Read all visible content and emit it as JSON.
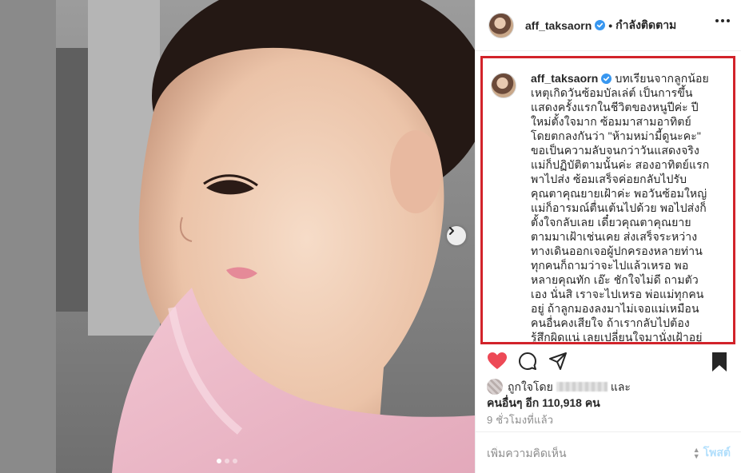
{
  "post": {
    "username": "aff_taksaorn",
    "separator": "•",
    "follow_status": "กำลังติดตาม",
    "caption": "บทเรียนจากลูกน้อย\nเหตุเกิดวันซ้อมบัลเล่ต์ เป็นการขึ้น\nแสดงครั้งแรกในชีวิตของหนูปีค่ะ ปี\nใหม่ตั้งใจมาก ซ้อมมาสามอาทิตย์\nโดยตกลงกันว่า \"ห้ามหม่ามี้ดูนะคะ\"\nขอเป็นความลับจนกว่าวันแสดงจริง\nแม่ก็ปฏิบัติตามนั้นค่ะ สองอาทิตย์แรก\nพาไปส่ง ซ้อมเสร็จค่อยกลับไปรับ\nคุณตาคุณยายเฝ้าค่ะ พอวันซ้อมใหญ่\nแม่ก็อารมณ์ตื่นเต้นไปด้วย พอไปส่งก็\nตั้งใจกลับเลย เดี๋ยวคุณตาคุณยาย\nตามมาเฝ้าเช่นเคย ส่งเสร็จระหว่าง\nทางเดินออกเจอผู้ปกครองหลายท่าน\nทุกคนก็ถามว่าจะไปแล้วเหรอ พอ\nหลายคุณทัก เอ๊ะ ชักใจไม่ดี ถามตัว\nเอง นั่นสิ เราจะไปเหรอ พ่อแม่ทุกคน\nอยู่ ถ้าลูกมองลงมาไม่เจอแม่เหมือน\nคนอื่นคงเสียใจ ถ้าเรากลับไปต้อง\nรู้สึกผิดแน่ เลยเปลี่ยนใจมานั่งเฝ้าอยู่",
    "liked_by_prefix": "ถูกใจโดย",
    "liked_by_suffix": "และ",
    "others_label": "คนอื่นๆ อีก 110,918 คน",
    "timestamp": "9 ชั่วโมงที่แล้ว",
    "comment_placeholder": "เพิ่มความคิดเห็น",
    "post_button": "โพสต์"
  },
  "carousel": {
    "total": 3,
    "active": 1
  },
  "colors": {
    "like_red": "#ed4956",
    "verified_blue": "#3897f0",
    "highlight_border": "#d2232a",
    "post_button_disabled": "#b2dffc"
  },
  "icons": {
    "like": "heart-icon",
    "comment": "comment-icon",
    "share": "share-icon",
    "save": "bookmark-icon",
    "more": "more-options-icon",
    "next": "chevron-right-icon"
  }
}
